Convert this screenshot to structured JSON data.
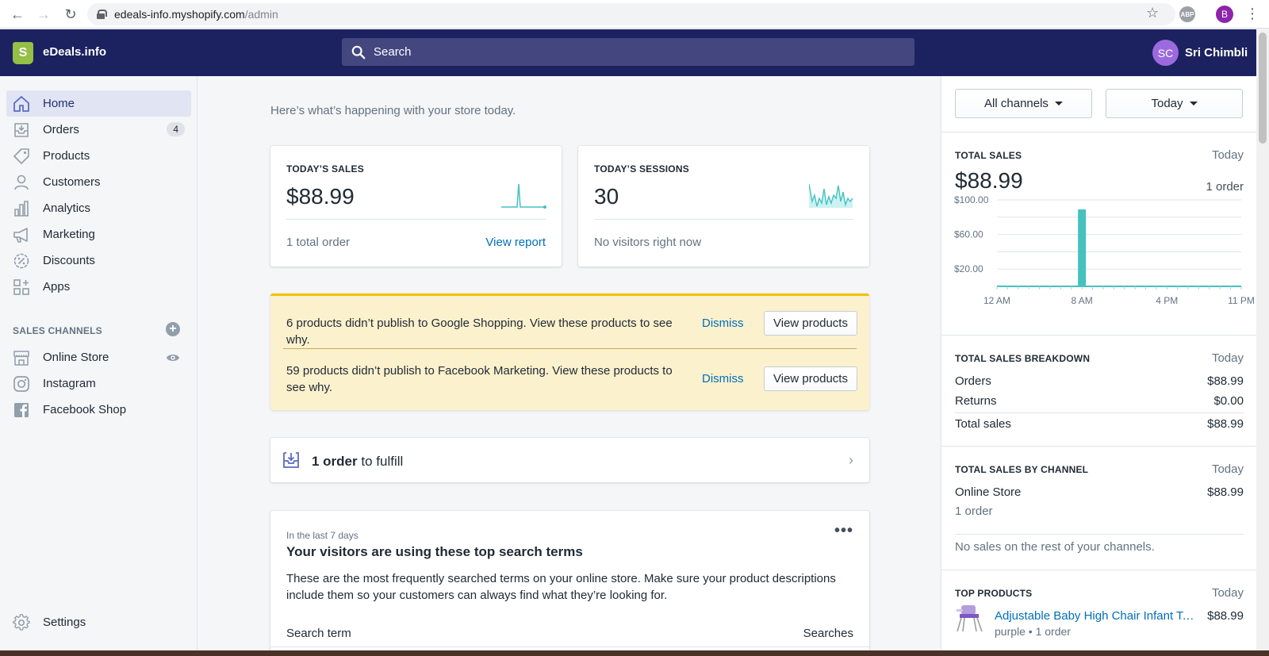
{
  "browser": {
    "url_host": "edeals-info.myshopify.com",
    "url_path": "/admin",
    "abp_label": "ABP",
    "profile_initial": "B"
  },
  "topbar": {
    "store_name": "eDeals.info",
    "search_placeholder": "Search",
    "user_initials": "SC",
    "user_name": "Sri Chimbli",
    "logo_letter": "S"
  },
  "sidebar": {
    "items": [
      {
        "label": "Home",
        "icon": "home-icon",
        "active": true
      },
      {
        "label": "Orders",
        "icon": "orders-icon",
        "badge": "4"
      },
      {
        "label": "Products",
        "icon": "tag-icon"
      },
      {
        "label": "Customers",
        "icon": "person-icon"
      },
      {
        "label": "Analytics",
        "icon": "bar-chart-icon"
      },
      {
        "label": "Marketing",
        "icon": "megaphone-icon"
      },
      {
        "label": "Discounts",
        "icon": "discount-icon"
      },
      {
        "label": "Apps",
        "icon": "apps-icon"
      }
    ],
    "sales_channels_title": "SALES CHANNELS",
    "channels": [
      {
        "label": "Online Store",
        "icon": "store-icon"
      },
      {
        "label": "Instagram",
        "icon": "instagram-icon"
      },
      {
        "label": "Facebook Shop",
        "icon": "facebook-icon"
      }
    ],
    "settings_label": "Settings"
  },
  "main": {
    "intro": "Here’s what’s happening with your store today.",
    "sales_card": {
      "label": "TODAY’S SALES",
      "value": "$88.99",
      "foot": "1 total order",
      "link": "View report"
    },
    "sessions_card": {
      "label": "TODAY’S SESSIONS",
      "value": "30",
      "foot": "No visitors right now"
    },
    "banner": {
      "row1": "6 products didn’t publish to Google Shopping. View these products to see why.",
      "row2": "59 products didn’t publish to Facebook Marketing. View these products to see why.",
      "dismiss": "Dismiss",
      "view_products": "View products"
    },
    "fulfill": {
      "bold": "1 order",
      "rest": " to fulfill"
    },
    "search_terms": {
      "subtitle": "In the last 7 days",
      "title": "Your visitors are using these top search terms",
      "body": "These are the most frequently searched terms on your online store. Make sure your product descriptions include them so your customers can always find what they’re looking for.",
      "col_term": "Search term",
      "col_searches": "Searches"
    }
  },
  "right": {
    "channel_filter": "All channels",
    "date_filter": "Today",
    "total_sales": {
      "title": "TOTAL SALES",
      "period": "Today",
      "value": "$88.99",
      "orders": "1 order"
    },
    "chart_data": {
      "type": "bar",
      "title": "",
      "ytick_labels": [
        "$100.00",
        "$60.00",
        "$20.00"
      ],
      "xtick_labels": [
        "12 AM",
        "8 AM",
        "4 PM",
        "11 PM"
      ],
      "x": [
        "12 AM",
        "1 AM",
        "2 AM",
        "3 AM",
        "4 AM",
        "5 AM",
        "6 AM",
        "7 AM",
        "8 AM",
        "9 AM",
        "10 AM",
        "11 AM",
        "12 PM",
        "1 PM",
        "2 PM",
        "3 PM",
        "4 PM",
        "5 PM",
        "6 PM",
        "7 PM",
        "8 PM",
        "9 PM",
        "10 PM",
        "11 PM"
      ],
      "values": [
        0,
        0,
        0,
        0,
        0,
        0,
        0,
        0,
        88.99,
        0,
        0,
        0,
        0,
        0,
        0,
        0,
        0,
        0,
        0,
        0,
        0,
        0,
        0,
        0
      ],
      "ylim": [
        0,
        100
      ],
      "grid": true,
      "color": "#47c1bf"
    },
    "breakdown": {
      "title": "TOTAL SALES BREAKDOWN",
      "period": "Today",
      "rows": [
        {
          "label": "Orders",
          "value": "$88.99"
        },
        {
          "label": "Returns",
          "value": "$0.00"
        },
        {
          "label": "Total sales",
          "value": "$88.99"
        }
      ]
    },
    "by_channel": {
      "title": "TOTAL SALES BY CHANNEL",
      "period": "Today",
      "channel": "Online Store",
      "value": "$88.99",
      "orders": "1 order",
      "note": "No sales on the rest of your channels."
    },
    "top_products": {
      "title": "TOP PRODUCTS",
      "period": "Today",
      "name": "Adjustable Baby High Chair Infant Tod...",
      "meta": "purple • 1 order",
      "price": "$88.99"
    }
  }
}
